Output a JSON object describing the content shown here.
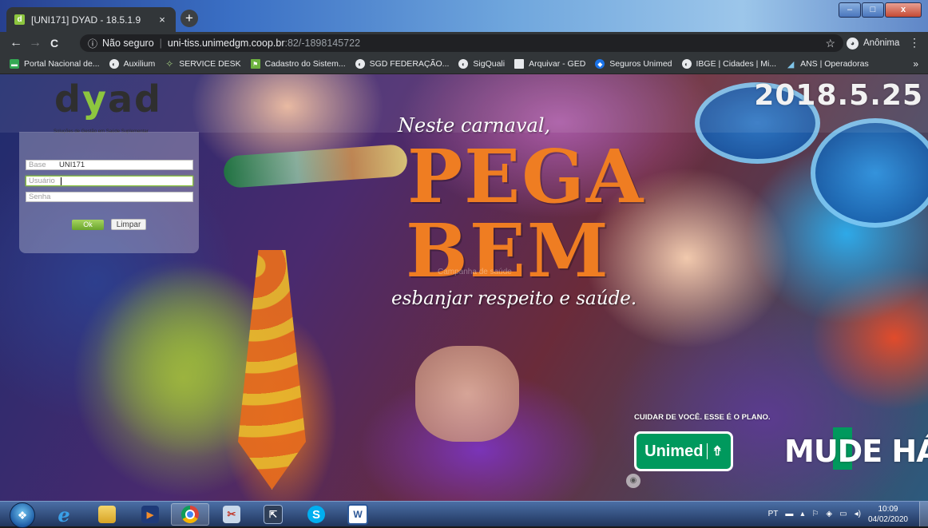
{
  "browser": {
    "tab_title": "[UNI171] DYAD - 18.5.1.9",
    "tab_close": "×",
    "new_tab": "+",
    "window_controls": {
      "minimize": "–",
      "maximize": "□",
      "close": "x"
    },
    "nav": {
      "back": "←",
      "forward": "→",
      "reload": "C"
    },
    "address": {
      "info_icon": "ⓘ",
      "security_label": "Não seguro",
      "separator": "|",
      "host": "uni-tiss.unimedgm.coop.br",
      "path": ":82/-1898145722",
      "star": "☆"
    },
    "profile_label": "Anônima",
    "menu": "⋮",
    "bookmarks": [
      {
        "label": "Portal Nacional de...",
        "icon": "monitor-icon",
        "glyph": "▬",
        "style": "green"
      },
      {
        "label": "Auxilium",
        "icon": "globe-icon",
        "glyph": "◐",
        "style": "globe"
      },
      {
        "label": "SERVICE DESK",
        "icon": "servicedesk-icon",
        "glyph": "✧",
        "style": "sd"
      },
      {
        "label": "Cadastro do Sistem...",
        "icon": "flag-icon",
        "glyph": "⚑",
        "style": "flag"
      },
      {
        "label": "SGD FEDERAÇÃO...",
        "icon": "globe-icon",
        "glyph": "◐",
        "style": "globe"
      },
      {
        "label": "SigQuali",
        "icon": "globe-icon",
        "glyph": "◐",
        "style": "globe"
      },
      {
        "label": "Arquivar - GED",
        "icon": "document-icon",
        "glyph": "",
        "style": "doc"
      },
      {
        "label": "Seguros Unimed",
        "icon": "unimed-icon",
        "glyph": "◆",
        "style": "blue"
      },
      {
        "label": "IBGE | Cidades | Mi...",
        "icon": "globe-icon",
        "glyph": "◐",
        "style": "globe"
      },
      {
        "label": "ANS | Operadoras",
        "icon": "ans-icon",
        "glyph": "◢",
        "style": "ans"
      }
    ],
    "bookmarks_more": "»"
  },
  "page": {
    "version": "2018.5.25",
    "logo": {
      "d": "d",
      "y": "y",
      "rest": "ad",
      "tagline": "Soluções de Gestão em Saúde Suplementar"
    },
    "login": {
      "base_label": "Base",
      "base_value": "UNI171",
      "user_label": "Usuário",
      "user_value": "",
      "password_label": "Senha",
      "ok_label": "Ok",
      "clear_label": "Limpar"
    },
    "campaign": {
      "line1": "Neste carnaval,",
      "word1": "PEGA",
      "word2": "BEM",
      "line3": "esbanjar respeito e saúde.",
      "faint_text": "Campanha de saúde",
      "tagline": "CUIDAR DE VOCÊ. ESSE É O PLANO.",
      "unimed_label": "Unimed",
      "unimed_icon": "⇮",
      "mude": "MUDE  HÁBI"
    },
    "scroll_glyph": "◉"
  },
  "taskbar": {
    "start_glyph": "❖",
    "apps": [
      {
        "name": "internet-explorer",
        "glyph": "e",
        "cls": "ie",
        "active": false
      },
      {
        "name": "file-explorer",
        "glyph": "",
        "cls": "explorer",
        "active": false
      },
      {
        "name": "media-player",
        "glyph": "▶",
        "cls": "media",
        "active": false
      },
      {
        "name": "chrome",
        "glyph": "",
        "cls": "chrome",
        "active": true
      },
      {
        "name": "snipping-tool",
        "glyph": "✂",
        "cls": "snip",
        "active": false
      },
      {
        "name": "remote-desktop",
        "glyph": "⇱",
        "cls": "rdp",
        "active": false
      },
      {
        "name": "skype",
        "glyph": "S",
        "cls": "skype",
        "active": false
      },
      {
        "name": "word",
        "glyph": "W",
        "cls": "word",
        "active": false
      }
    ],
    "tray": {
      "lang": "PT",
      "time": "10:09",
      "date": "04/02/2020"
    }
  }
}
